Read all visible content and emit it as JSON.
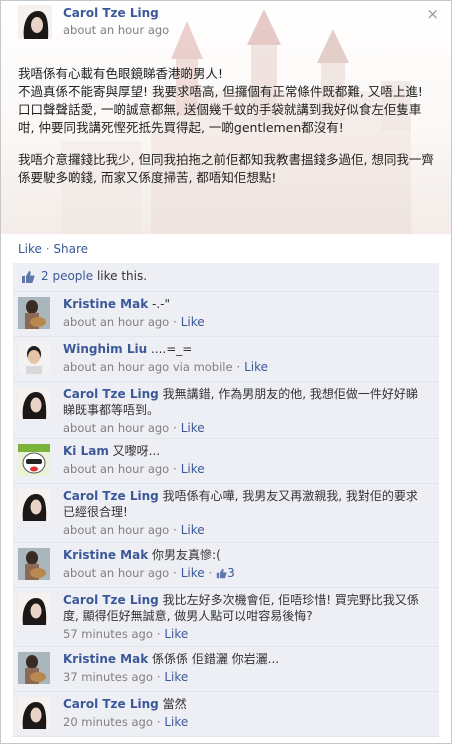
{
  "post": {
    "author": "Carol Tze Ling",
    "time": "about an hour ago",
    "paragraphs": [
      "我唔係有心載有色眼鏡睇香港啲男人!\n不過真係不能寄與厚望! 我要求唔高, 但攞個有正常條件既都難, 又唔上進! 口口聲聲話愛, 一啲誠意都無, 送個幾千蚊的手袋就講到我好似食左佢隻車咁, 仲要同我講死慳死抵先買得起, 一啲gentlemen都沒有!",
      "我唔介意攞錢比我少, 但同我拍拖之前佢都知我教書搵錢多過佢, 想同我一齊係要駛多啲錢, 而家又係度掃苦, 都唔知佢想點!"
    ],
    "close_glyph": "×",
    "like_label": "Like",
    "share_label": "Share",
    "separator": "·"
  },
  "likes": {
    "count_label": "2 people",
    "suffix": " like this.",
    "icon": "thumbs-up-icon"
  },
  "comments": [
    {
      "author": "Kristine Mak",
      "text": "-.-\"",
      "time": "about an hour ago",
      "action": "Like",
      "avatar": "guitar-photo"
    },
    {
      "author": "Winghim Liu",
      "text": "....=_=",
      "time": "about an hour ago via mobile",
      "action": "Like",
      "avatar": "boy-photo"
    },
    {
      "author": "Carol Tze Ling",
      "text": "我無講錯, 作為男朋友的他, 我想佢做一件好好睇睇既事都等唔到。",
      "time": "about an hour ago",
      "action": "Like",
      "avatar": "dark-hair-photo"
    },
    {
      "author": "Ki Lam",
      "text": "又嚟呀...",
      "time": "about an hour ago",
      "action": "Like",
      "avatar": "cartoon-bear"
    },
    {
      "author": "Carol Tze Ling",
      "text": "我唔係有心嘩, 我男友又再激親我, 我對佢的要求已經很合理!",
      "time": "about an hour ago",
      "action": "Like",
      "avatar": "dark-hair-photo"
    },
    {
      "author": "Kristine Mak",
      "text": "你男友真慘:(",
      "time": "about an hour ago",
      "action": "Like",
      "like_count": "3",
      "avatar": "guitar-photo"
    },
    {
      "author": "Carol Tze Ling",
      "text": "我比左好多次機會佢, 佢唔珍惜! 買完野比我又係度, 顯得佢好無誠意, 做男人點可以咁容易後悔?",
      "time": "57 minutes ago",
      "action": "Like",
      "avatar": "dark-hair-photo"
    },
    {
      "author": "Kristine Mak",
      "text": "係係係 佢錯灑 你岩灑...",
      "time": "37 minutes ago",
      "action": "Like",
      "avatar": "guitar-photo"
    },
    {
      "author": "Carol Tze Ling",
      "text": "當然",
      "time": "20 minutes ago",
      "action": "Like",
      "avatar": "dark-hair-photo"
    }
  ],
  "colors": {
    "link": "#3b5998",
    "comment_bg": "#edeff4",
    "meta": "#808080"
  }
}
